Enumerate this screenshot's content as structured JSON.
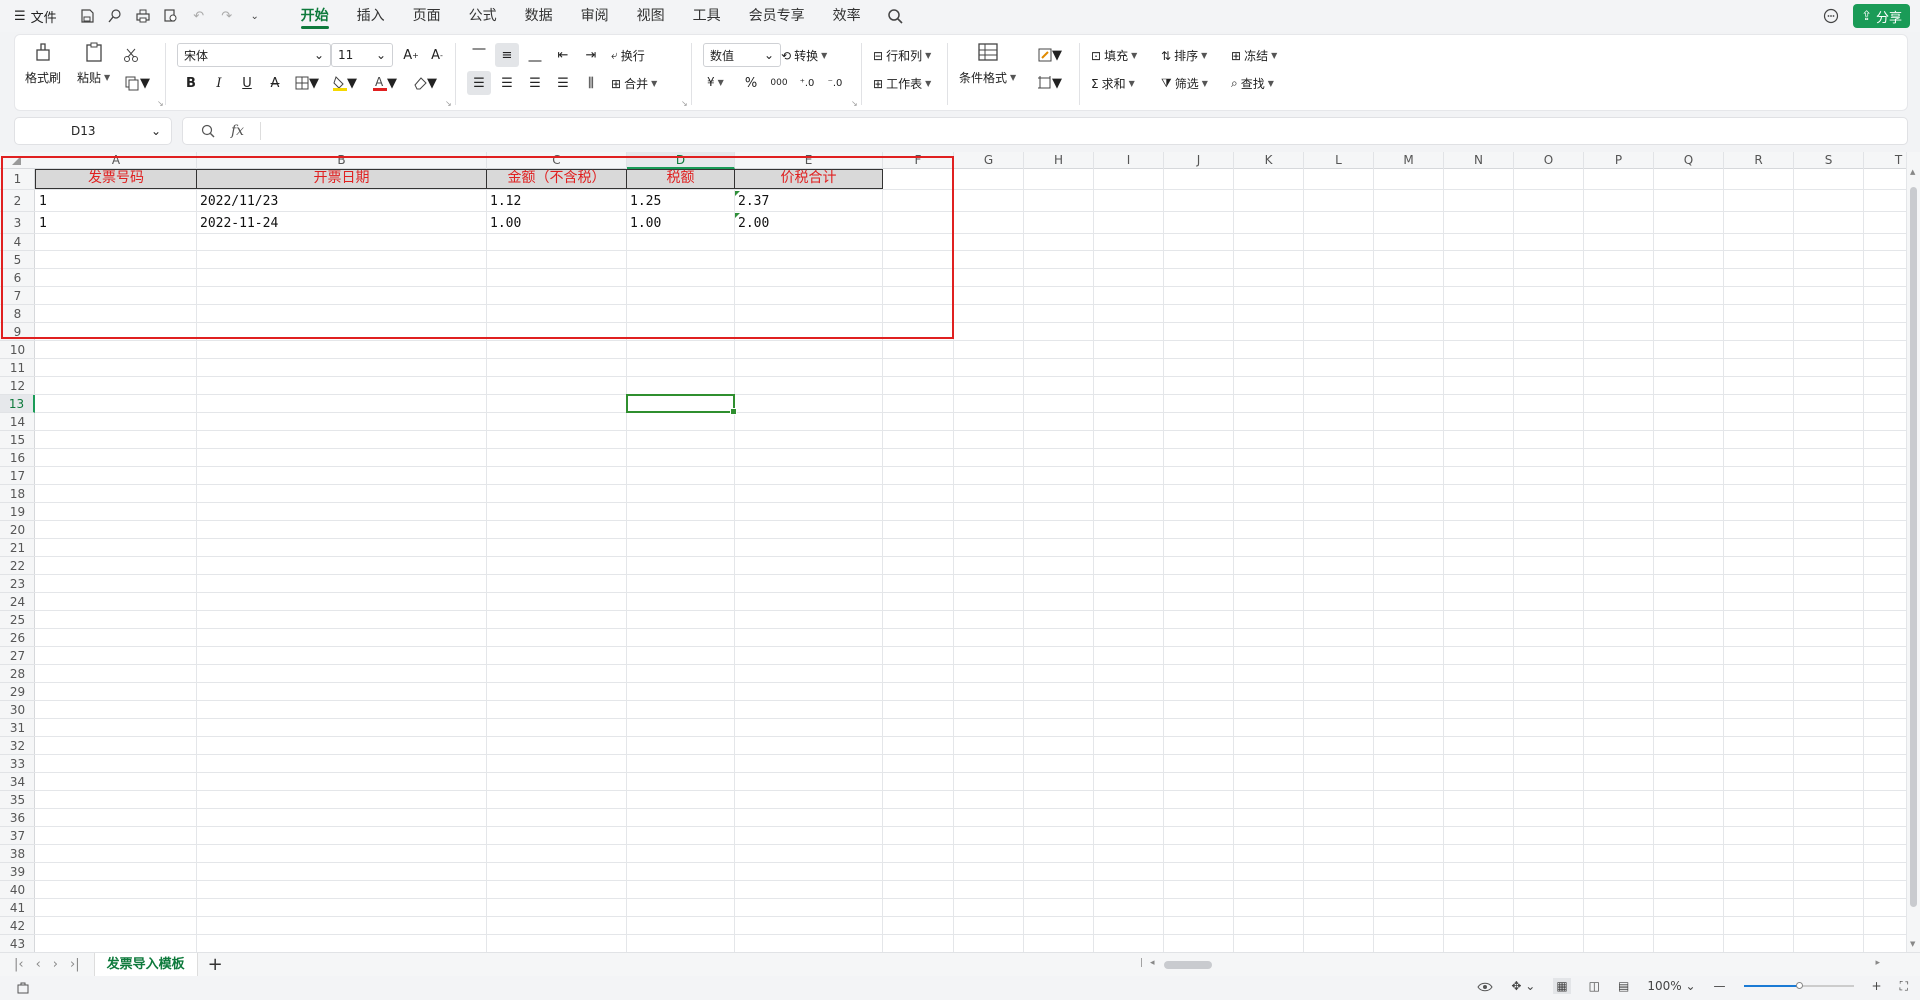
{
  "menu": {
    "file": "文件",
    "tabs": [
      "开始",
      "插入",
      "页面",
      "公式",
      "数据",
      "审阅",
      "视图",
      "工具",
      "会员专享",
      "效率"
    ],
    "share": "分享"
  },
  "ribbon": {
    "format_painter": "格式刷",
    "paste": "粘贴",
    "font_name": "宋体",
    "font_size": "11",
    "wrap": "换行",
    "merge": "合并",
    "number_format": "数值",
    "convert": "转换",
    "rows_cols": "行和列",
    "worksheet": "工作表",
    "cond_format": "条件格式",
    "fill": "填充",
    "sort": "排序",
    "freeze": "冻结",
    "sum": "求和",
    "filter": "筛选",
    "find": "查找",
    "currency": "¥",
    "percent": "%",
    "thousands": "000"
  },
  "formula_bar": {
    "cell_ref": "D13",
    "fx": "fx",
    "value": ""
  },
  "columns": [
    "A",
    "B",
    "C",
    "D",
    "E",
    "F",
    "G",
    "H",
    "I",
    "J",
    "K",
    "L",
    "M",
    "N",
    "O",
    "P",
    "Q",
    "R",
    "S",
    "T"
  ],
  "rows_count": 43,
  "active_cell": {
    "col": "D",
    "row": 13
  },
  "table": {
    "headers": [
      "发票号码",
      "开票日期",
      "金额（不含税）",
      "税额",
      "价税合计"
    ],
    "rows": [
      [
        "1",
        "2022/11/23",
        "1.12",
        "1.25",
        "2.37"
      ],
      [
        "1",
        "2022-11-24",
        "1.00",
        "1.00",
        "2.00"
      ]
    ]
  },
  "sheet_tabs": [
    "发票导入模板"
  ],
  "status": {
    "zoom": "100%",
    "zoom_fraction": 0.5
  },
  "colors": {
    "accent": "#1a9b57",
    "header_text": "#e02020",
    "highlight_rect": "#e02020"
  }
}
